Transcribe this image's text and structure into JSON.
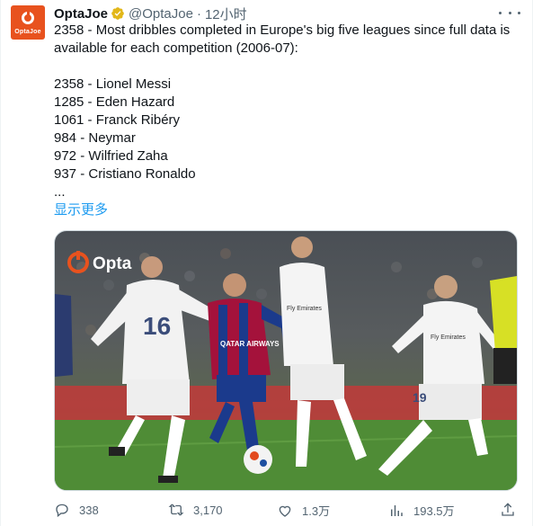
{
  "author": {
    "name": "OptaJoe",
    "handle": "@OptaJoe",
    "time": "12小时",
    "avatar_text": "OptaJoe",
    "separator": "·"
  },
  "tweet": {
    "lines": [
      "2358 - Most dribbles completed in Europe's big five leagues since full data is available for each competition (2006-07):",
      "",
      "2358 - Lionel Messi",
      "1285 - Eden Hazard",
      "1061 - Franck Ribéry",
      "984 - Neymar",
      "972 - Wilfried Zaha",
      "937 - Cristiano Ronaldo",
      "..."
    ],
    "show_more": "显示更多"
  },
  "media": {
    "watermark": "Opta",
    "jersey_numbers": [
      "16",
      "19"
    ],
    "sponsor": "Fly Emirates",
    "qatar": "QATAR AIRWAYS"
  },
  "actions": {
    "replies": "338",
    "retweets": "3,170",
    "likes": "1.3万",
    "views": "193.5万"
  },
  "colors": {
    "accent": "#1d9bf0",
    "verified": "#e2b719",
    "opta_orange": "#e8521e",
    "muted": "#536471"
  }
}
